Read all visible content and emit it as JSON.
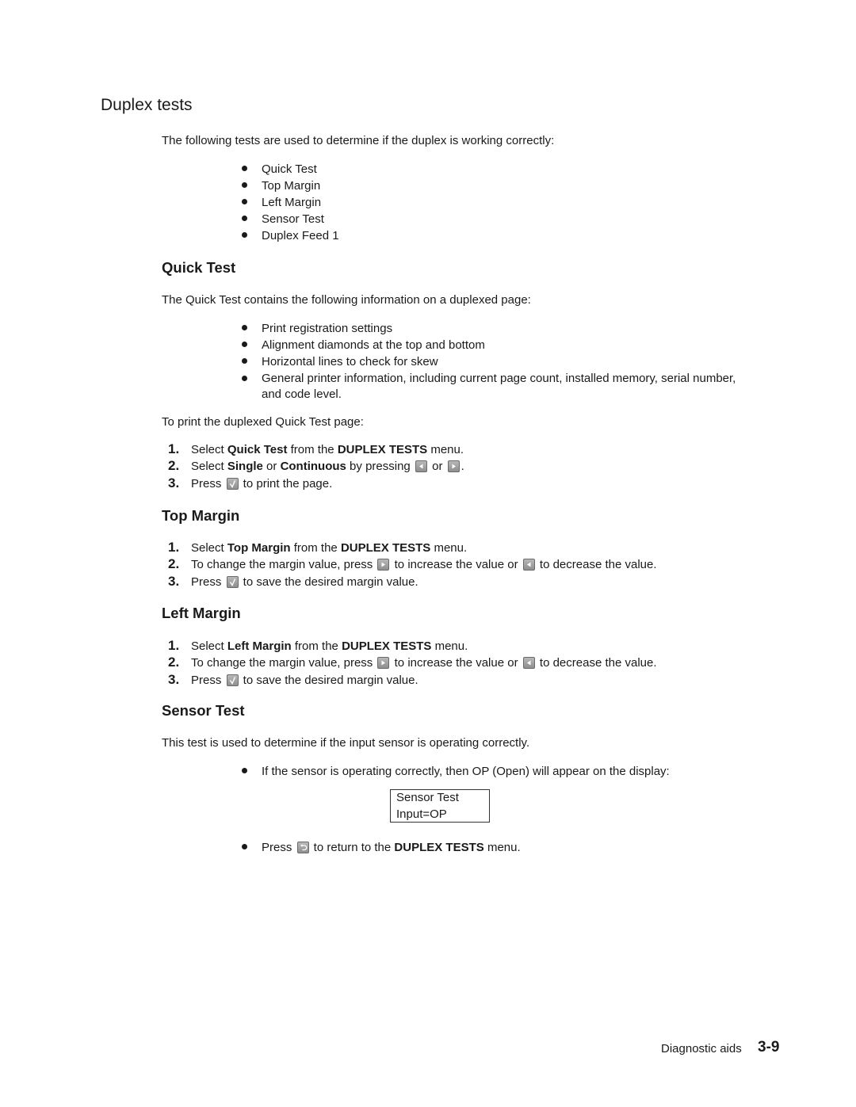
{
  "page_title": "Duplex tests",
  "intro": "The following tests are used to determine if the duplex is working correctly:",
  "test_list": [
    "Quick Test",
    "Top Margin",
    "Left Margin",
    "Sensor Test",
    "Duplex Feed 1"
  ],
  "quick_test": {
    "heading": "Quick Test",
    "intro": "The Quick Test contains the following information on a duplexed page:",
    "items": [
      "Print registration settings",
      "Alignment diamonds at the top and bottom",
      "Horizontal lines to check for skew",
      "General printer information, including current page count, installed memory, serial number,",
      "and code level."
    ],
    "print_intro": "To print the duplexed Quick Test page:",
    "steps": [
      {
        "num": "1.",
        "t1": "Select ",
        "b1": "Quick Test",
        "t2": " from the ",
        "b2": "DUPLEX TESTS",
        "t3": " menu."
      },
      {
        "num": "2.",
        "t1": "Select ",
        "b1": "Single",
        "t2": " or ",
        "b2": "Continuous",
        "t3": " by pressing ",
        "t4": " or ",
        "t5": "."
      },
      {
        "num": "3.",
        "t1": "Press ",
        "t2": " to print the page."
      }
    ]
  },
  "top_margin": {
    "heading": "Top Margin",
    "steps": [
      {
        "num": "1.",
        "t1": "Select ",
        "b1": "Top Margin",
        "t2": " from the ",
        "b2": "DUPLEX TESTS",
        "t3": " menu."
      },
      {
        "num": "2.",
        "t1": "To change the margin value, press ",
        "t2": " to increase the value or ",
        "t3": " to decrease the value."
      },
      {
        "num": "3.",
        "t1": "Press ",
        "t2": " to save the desired margin value."
      }
    ]
  },
  "left_margin": {
    "heading": "Left Margin",
    "steps": [
      {
        "num": "1.",
        "t1": "Select ",
        "b1": "Left Margin",
        "t2": " from the ",
        "b2": "DUPLEX TESTS",
        "t3": " menu."
      },
      {
        "num": "2.",
        "t1": "To change the margin value, press ",
        "t2": " to increase the value or ",
        "t3": " to decrease the value."
      },
      {
        "num": "3.",
        "t1": "Press ",
        "t2": " to save the desired margin value."
      }
    ]
  },
  "sensor_test": {
    "heading": "Sensor Test",
    "intro": "This test is used to determine if the input sensor is operating correctly.",
    "bullet1": "If the sensor is operating correctly, then OP (Open) will appear on the display:",
    "display_line1": "Sensor Test",
    "display_line2": "Input=OP",
    "bullet2_t1": "Press ",
    "bullet2_t2": " to return to the ",
    "bullet2_b": "DUPLEX TESTS",
    "bullet2_t3": " menu."
  },
  "footer": {
    "label": "Diagnostic aids",
    "page": "3-9"
  },
  "icons": {
    "left": "left-arrow-button-icon",
    "right": "right-arrow-button-icon",
    "select": "select-check-button-icon",
    "back": "back-button-icon"
  }
}
